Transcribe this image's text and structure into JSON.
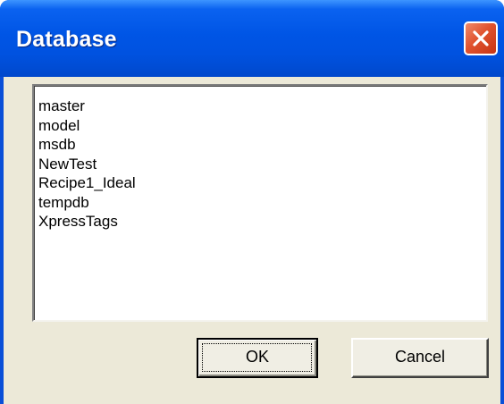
{
  "window": {
    "title": "Database"
  },
  "database_list": {
    "items": [
      {
        "label": "master"
      },
      {
        "label": "model"
      },
      {
        "label": "msdb"
      },
      {
        "label": "NewTest"
      },
      {
        "label": "Recipe1_Ideal"
      },
      {
        "label": "tempdb"
      },
      {
        "label": "XpressTags"
      }
    ]
  },
  "buttons": {
    "ok_label": "OK",
    "cancel_label": "Cancel"
  },
  "colors": {
    "titlebar": "#0055e5",
    "close_button": "#e0532f",
    "client_background": "#ece9d8",
    "list_background": "#ffffff"
  }
}
